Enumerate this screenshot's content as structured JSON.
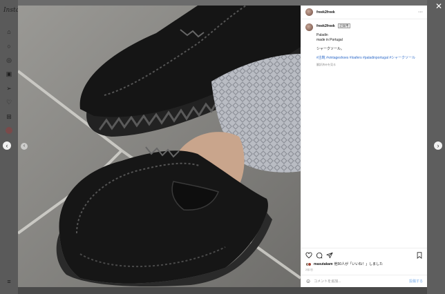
{
  "background": {
    "logo_text": "Insta",
    "nav_icons": [
      "home-icon",
      "search-icon",
      "explore-icon",
      "reels-icon",
      "messages-icon",
      "heart-icon",
      "create-icon",
      "profile-avatar"
    ],
    "menu_icon": "menu-icon"
  },
  "controls": {
    "close_glyph": "✕",
    "prev_glyph": "‹",
    "next_glyph": "›",
    "photo_prev_glyph": "‹"
  },
  "post": {
    "username": "freek2freek",
    "more_glyph": "···",
    "caption_user": "freek2freek",
    "edited_badge": "記録用",
    "caption_lines": [
      "Paladin",
      "made in Portugal"
    ],
    "caption_jp": "シャークソール。",
    "hashtags": "#古靴 #vintageshoes #loafers #paladinportugal #シャークソール",
    "translate_text": "翻訳済みを見る",
    "likes_user": "masutakam",
    "likes_text": "他50人が「いいね！」しました",
    "date": "2月2日",
    "comment_placeholder": "コメントを追加...",
    "post_button": "投稿する"
  },
  "colors": {
    "link": "#2d6ac9",
    "post_button_disabled": "#a8c9f0",
    "overlay": "#6b6b6b"
  }
}
